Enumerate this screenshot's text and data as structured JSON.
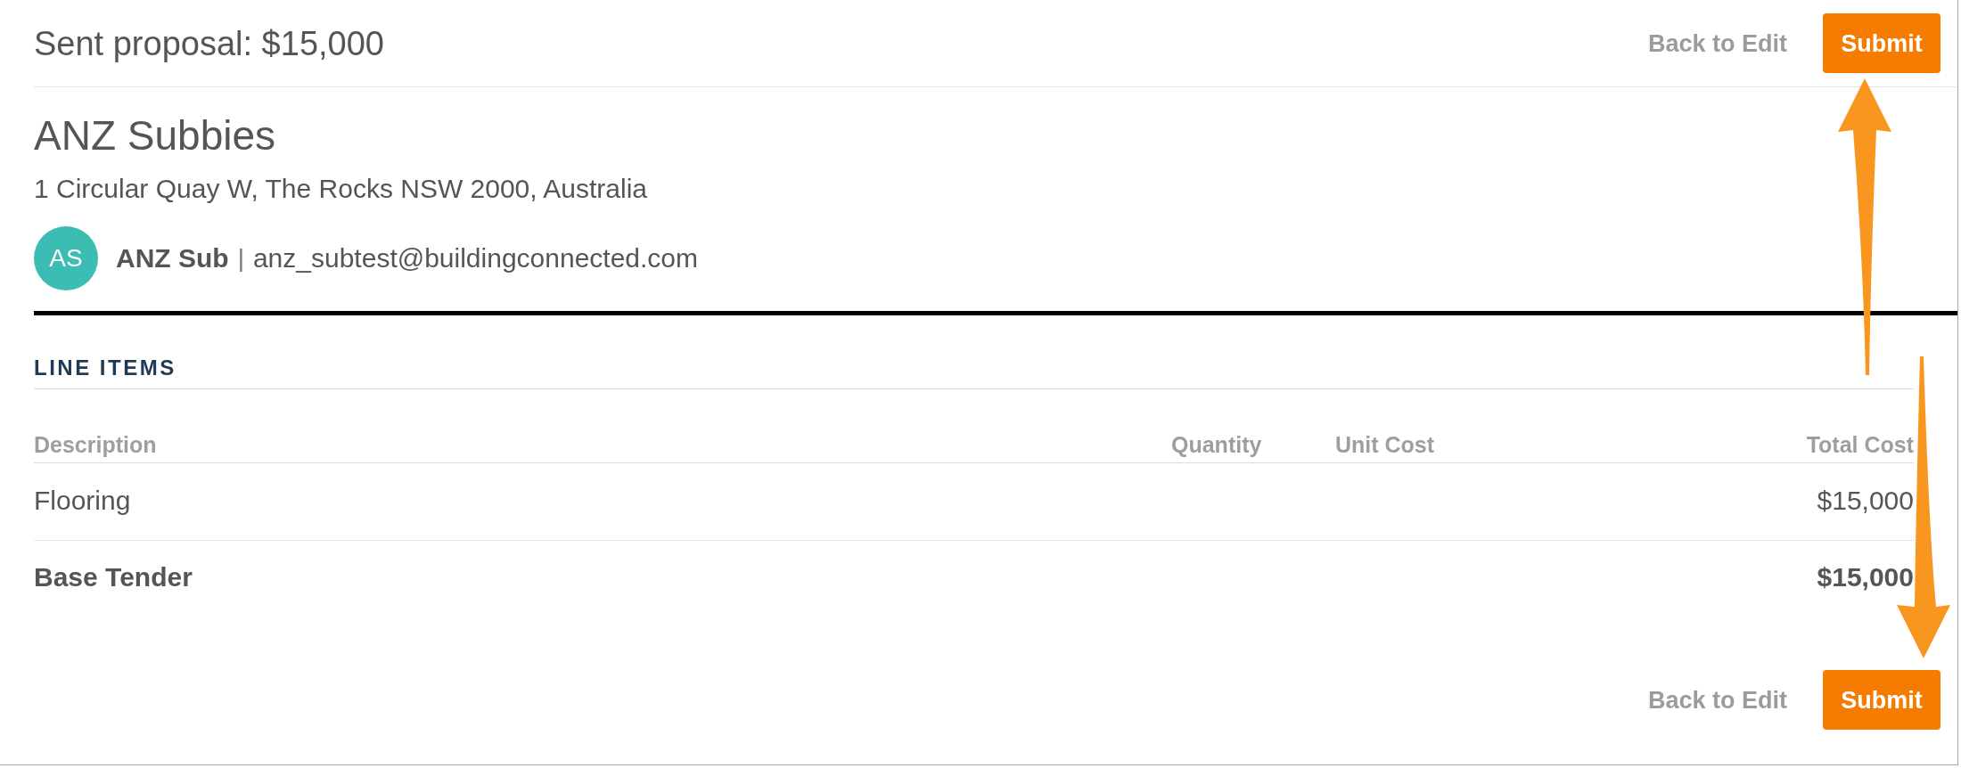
{
  "header": {
    "title": "Sent proposal: $15,000",
    "actions": [
      {
        "kind": "link",
        "label": "Back to Edit"
      },
      {
        "kind": "primary",
        "label": "Submit"
      }
    ]
  },
  "company": {
    "name": "ANZ Subbies",
    "address": "1 Circular Quay W, The Rocks NSW 2000, Australia",
    "contact": {
      "initials": "AS",
      "name": "ANZ Sub",
      "separator": "|",
      "email": "anz_subtest@buildingconnected.com"
    }
  },
  "line_items": {
    "title": "LINE ITEMS",
    "columns": [
      "Description",
      "Quantity",
      "Unit Cost",
      "Total Cost"
    ],
    "rows": [
      {
        "kind": "item",
        "description": "Flooring",
        "total_cost": "$15,000"
      },
      {
        "kind": "total",
        "description": "Base Tender",
        "total_cost": "$15,000"
      }
    ]
  },
  "footer": {
    "actions": [
      {
        "kind": "link",
        "label": "Back to Edit"
      },
      {
        "kind": "primary",
        "label": "Submit"
      }
    ]
  },
  "annotations": [
    {
      "kind": "up"
    },
    {
      "kind": "down"
    }
  ]
}
